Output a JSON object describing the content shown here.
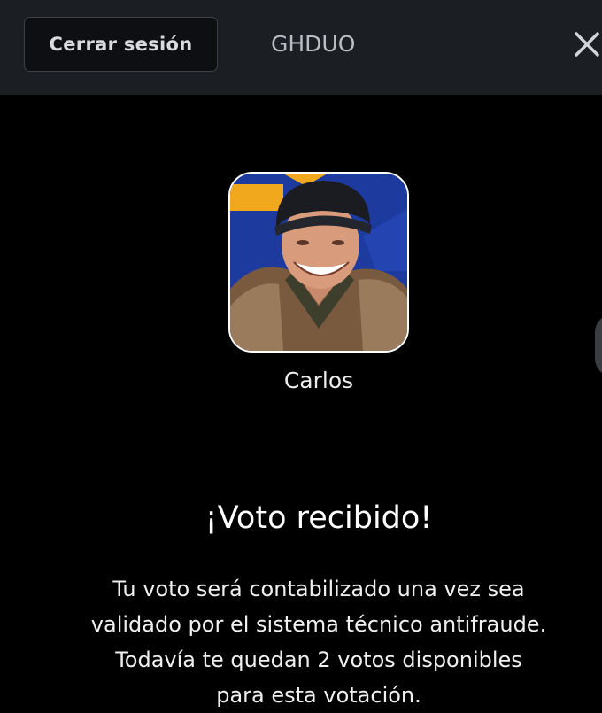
{
  "header": {
    "logout_label": "Cerrar sesión",
    "user_code": "GHDUO",
    "close_icon": "close-icon"
  },
  "vote": {
    "contestant_name": "Carlos",
    "avatar_icon": "contestant-photo",
    "title": "¡Voto recibido!",
    "message_line1": "Tu voto será contabilizado una vez sea",
    "message_line2": "validado por el sistema técnico antifraude.",
    "message_line3": "Todavía te quedan 2 votos disponibles",
    "message_line4": "para esta votación."
  },
  "colors": {
    "background": "#000000",
    "topbar": "#1b1f24",
    "button_bg": "#0d0f12",
    "avatar_bg": "#1d3a9e",
    "avatar_accent": "#f2a81d"
  }
}
